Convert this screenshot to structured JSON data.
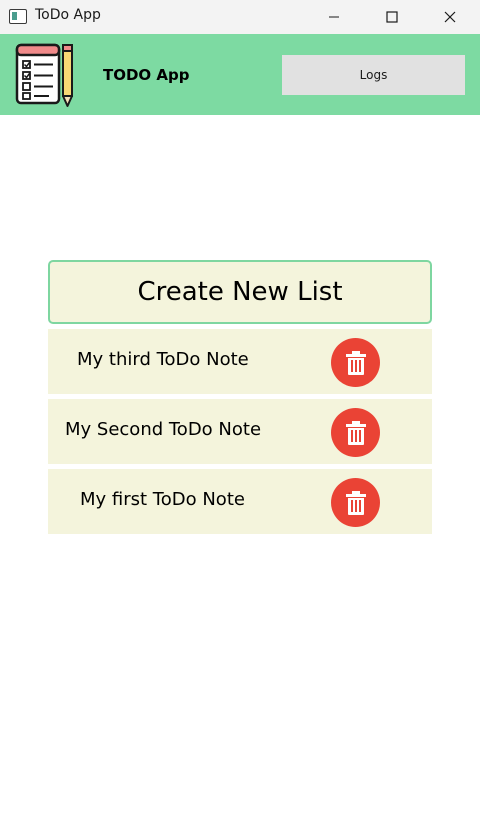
{
  "window": {
    "title": "ToDo App",
    "controls": [
      "minimize-icon",
      "maximize-icon",
      "close-icon"
    ]
  },
  "header": {
    "title": "TODO App",
    "logs_label": "Logs",
    "logo_icon": "checklist-pencil-icon",
    "background": "#7ddaa2"
  },
  "main": {
    "create_label": "Create New List",
    "notes": [
      {
        "label": "My third ToDo Note",
        "action_icon": "trash-icon"
      },
      {
        "label": "My Second ToDo Note",
        "action_icon": "trash-icon"
      },
      {
        "label": "My first ToDo Note",
        "action_icon": "trash-icon"
      }
    ]
  },
  "colors": {
    "card_background": "#f4f4dc",
    "card_border": "#7ed6a0",
    "delete_button": "#ea4335"
  }
}
